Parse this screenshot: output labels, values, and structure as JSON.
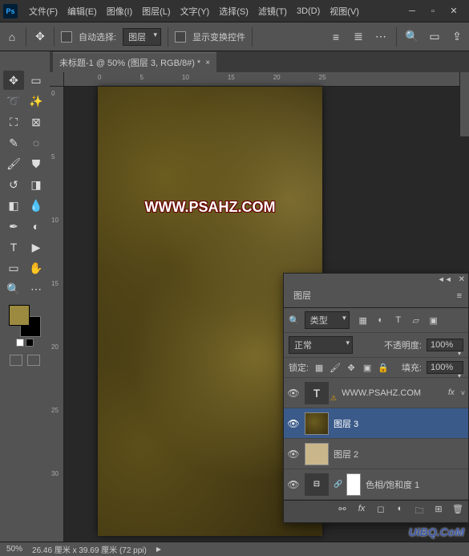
{
  "menu": {
    "file": "文件(F)",
    "edit": "编辑(E)",
    "image": "图像(I)",
    "layer": "图层(L)",
    "type": "文字(Y)",
    "select": "选择(S)",
    "filter": "滤镜(T)",
    "3d": "3D(D)",
    "view": "视图(V)"
  },
  "options": {
    "auto_select": "自动选择:",
    "auto_select_mode": "图层",
    "show_transform": "显示变换控件"
  },
  "document": {
    "tab_title": "未标题-1 @ 50% (图层 3, RGB/8#) *",
    "canvas_text": "WWW.PSAHZ.COM"
  },
  "ruler": {
    "h": [
      "0",
      "5",
      "10",
      "15",
      "20",
      "25"
    ],
    "v": [
      "0",
      "5",
      "10",
      "15",
      "20",
      "25",
      "30"
    ]
  },
  "swatches": {
    "fg": "#9b8a3f",
    "bg": "#000000"
  },
  "layers_panel": {
    "title": "图层",
    "filter_label": "类型",
    "blend_mode": "正常",
    "opacity_label": "不透明度:",
    "opacity_value": "100%",
    "lock_label": "锁定:",
    "fill_label": "填充:",
    "fill_value": "100%",
    "layers": [
      {
        "name": "WWW.PSAHZ.COM",
        "type": "text",
        "visible": true,
        "fx": true,
        "warn": true
      },
      {
        "name": "图层 3",
        "type": "cloud",
        "visible": true,
        "selected": true
      },
      {
        "name": "图层 2",
        "type": "tan",
        "visible": true
      },
      {
        "name": "色相/饱和度 1",
        "type": "adjustment",
        "visible": true,
        "clip": true
      }
    ]
  },
  "status": {
    "zoom": "50%",
    "doc_size": "26.46 厘米 x 39.69 厘米 (72 ppi)"
  },
  "watermark": "UiBQ.CoM"
}
